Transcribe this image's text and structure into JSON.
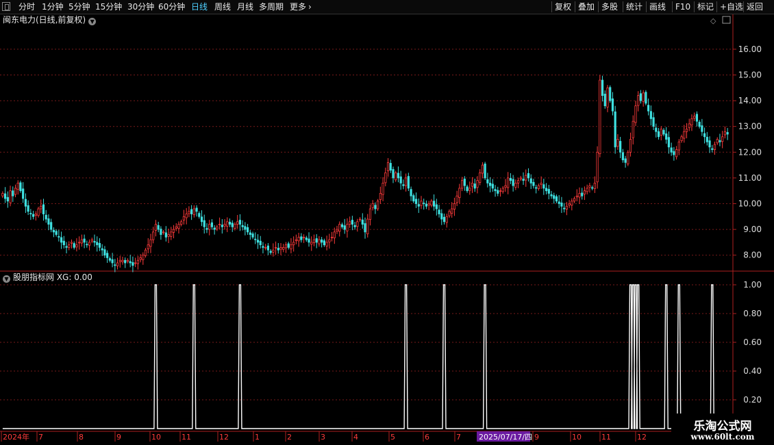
{
  "toolbar": {
    "periods": [
      "分时",
      "1分钟",
      "5分钟",
      "15分钟",
      "30分钟",
      "60分钟",
      "日线",
      "周线",
      "月线",
      "多周期",
      "更多"
    ],
    "active_period": "日线",
    "actions": [
      "复权",
      "叠加",
      "多股",
      "统计",
      "画线",
      "F10",
      "标记",
      "+自选",
      "返回"
    ]
  },
  "main": {
    "title": "闽东电力(日线,前复权)",
    "price_ticks": [
      "16.00",
      "15.00",
      "14.00",
      "13.00",
      "12.00",
      "11.00",
      "10.00",
      "9.00",
      "8.00"
    ]
  },
  "indicator": {
    "title": "股朋指标网 XG: 0.00",
    "ticks": [
      "1.00",
      "0.80",
      "0.60",
      "0.40",
      "0.20"
    ]
  },
  "time_axis": {
    "labels": [
      "2024年",
      "7",
      "8",
      "9",
      "10",
      "11",
      "12",
      "1",
      "2",
      "3",
      "4",
      "5",
      "6",
      "7",
      "9",
      "10",
      "11",
      "12"
    ],
    "cursor_date": "2025/07/17/四"
  },
  "watermark": {
    "line1": "乐淘公式网",
    "line2": "www.60lt.com"
  },
  "colors": {
    "up": "#ff3b3b",
    "down": "#3ee0e0",
    "grid": "#7a1a1a",
    "axis": "#b02020",
    "indicator_line": "#ffffff",
    "active_period": "#4fd0ff",
    "cursor_bg": "#6a1aa0"
  },
  "chart_data": {
    "type": "candlestick",
    "price_range": [
      7.3,
      16.8
    ],
    "closes": [
      10.4,
      10.2,
      10.1,
      10.5,
      10.3,
      10.6,
      10.8,
      10.5,
      10.2,
      9.9,
      9.7,
      9.6,
      9.5,
      9.6,
      9.8,
      9.9,
      9.6,
      9.4,
      9.2,
      9.0,
      8.9,
      8.8,
      8.7,
      8.5,
      8.4,
      8.3,
      8.4,
      8.5,
      8.3,
      8.4,
      8.5,
      8.6,
      8.5,
      8.4,
      8.5,
      8.6,
      8.5,
      8.4,
      8.3,
      8.2,
      8.0,
      7.9,
      7.8,
      7.7,
      7.6,
      7.7,
      7.8,
      7.8,
      7.7,
      7.8,
      7.7,
      7.6,
      7.7,
      7.8,
      7.9,
      8.0,
      8.2,
      8.4,
      8.6,
      8.9,
      9.2,
      9.0,
      8.8,
      8.9,
      8.7,
      8.8,
      8.9,
      9.0,
      9.1,
      9.2,
      9.3,
      9.5,
      9.6,
      9.7,
      9.6,
      9.8,
      9.7,
      9.5,
      9.3,
      9.1,
      9.0,
      9.2,
      9.1,
      9.0,
      9.1,
      9.2,
      9.1,
      9.2,
      9.3,
      9.2,
      9.1,
      9.2,
      9.3,
      9.2,
      9.1,
      9.0,
      8.9,
      8.8,
      8.7,
      8.6,
      8.5,
      8.4,
      8.3,
      8.3,
      8.2,
      8.1,
      8.2,
      8.3,
      8.2,
      8.3,
      8.3,
      8.4,
      8.3,
      8.4,
      8.5,
      8.6,
      8.7,
      8.6,
      8.7,
      8.6,
      8.5,
      8.5,
      8.6,
      8.5,
      8.6,
      8.5,
      8.4,
      8.5,
      8.6,
      8.7,
      8.9,
      9.0,
      9.2,
      9.1,
      9.0,
      9.2,
      9.3,
      9.2,
      9.1,
      9.3,
      9.4,
      9.2,
      8.9,
      9.4,
      9.8,
      10.0,
      9.8,
      10.1,
      10.4,
      10.8,
      11.2,
      11.6,
      11.3,
      11.0,
      11.2,
      11.0,
      10.8,
      10.7,
      11.0,
      10.6,
      10.3,
      10.1,
      10.0,
      9.9,
      10.1,
      10.0,
      9.9,
      10.0,
      10.1,
      9.9,
      9.8,
      9.6,
      9.4,
      9.3,
      9.5,
      9.7,
      9.8,
      10.0,
      10.3,
      10.6,
      10.9,
      10.7,
      10.5,
      10.6,
      10.8,
      10.6,
      10.9,
      11.2,
      11.5,
      11.0,
      10.8,
      10.7,
      10.6,
      10.5,
      10.4,
      10.5,
      10.6,
      10.7,
      11.0,
      10.9,
      10.7,
      10.8,
      10.9,
      11.0,
      10.9,
      11.1,
      11.0,
      10.8,
      10.7,
      10.6,
      10.7,
      10.8,
      10.6,
      10.5,
      10.4,
      10.3,
      10.2,
      10.1,
      10.0,
      9.9,
      9.8,
      9.9,
      10.0,
      10.1,
      10.2,
      10.3,
      10.4,
      10.3,
      10.5,
      10.6,
      10.7,
      10.6,
      10.8,
      12.0,
      14.8,
      14.2,
      13.8,
      14.5,
      14.0,
      13.6,
      12.2,
      12.5,
      12.0,
      11.7,
      11.6,
      12.0,
      12.5,
      13.2,
      13.8,
      14.2,
      14.0,
      14.3,
      13.9,
      13.6,
      13.3,
      13.0,
      12.8,
      12.6,
      12.9,
      12.7,
      12.5,
      12.2,
      12.0,
      11.9,
      12.1,
      12.4,
      12.6,
      12.8,
      12.9,
      13.1,
      13.3,
      13.4,
      13.2,
      13.0,
      12.8,
      12.6,
      12.4,
      12.2,
      12.1,
      12.3,
      12.5,
      12.4,
      12.6,
      12.8,
      12.7
    ],
    "xg_signal_indices": [
      60,
      75,
      93,
      158,
      173,
      189,
      246,
      247,
      248,
      249,
      260,
      265,
      278
    ]
  }
}
